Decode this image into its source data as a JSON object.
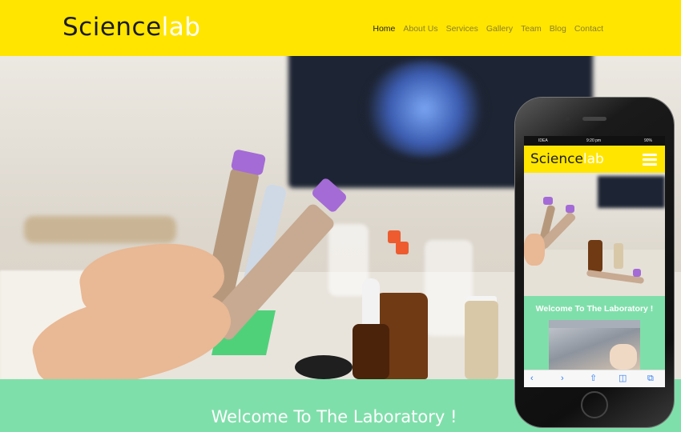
{
  "brand": {
    "part1": "Science",
    "part2": "lab"
  },
  "nav": [
    {
      "label": "Home",
      "active": true
    },
    {
      "label": "About Us"
    },
    {
      "label": "Services"
    },
    {
      "label": "Gallery"
    },
    {
      "label": "Team"
    },
    {
      "label": "Blog"
    },
    {
      "label": "Contact"
    }
  ],
  "hero": {
    "welcome": "Welcome To The Laboratory !"
  },
  "phone": {
    "status": {
      "carrier": "IDEA",
      "time": "9:20 pm",
      "battery": "90%"
    },
    "logo": {
      "part1": "Science",
      "part2": "lab"
    },
    "welcome": "Welcome To The Laboratory !",
    "toolbar": [
      "back-icon",
      "forward-icon",
      "share-icon",
      "bookmarks-icon",
      "tabs-icon"
    ]
  },
  "colors": {
    "header_yellow": "#ffe500",
    "band_green": "#7fdfaa",
    "logo_dark": "#1c1c1c",
    "logo_white": "#ffffff"
  }
}
